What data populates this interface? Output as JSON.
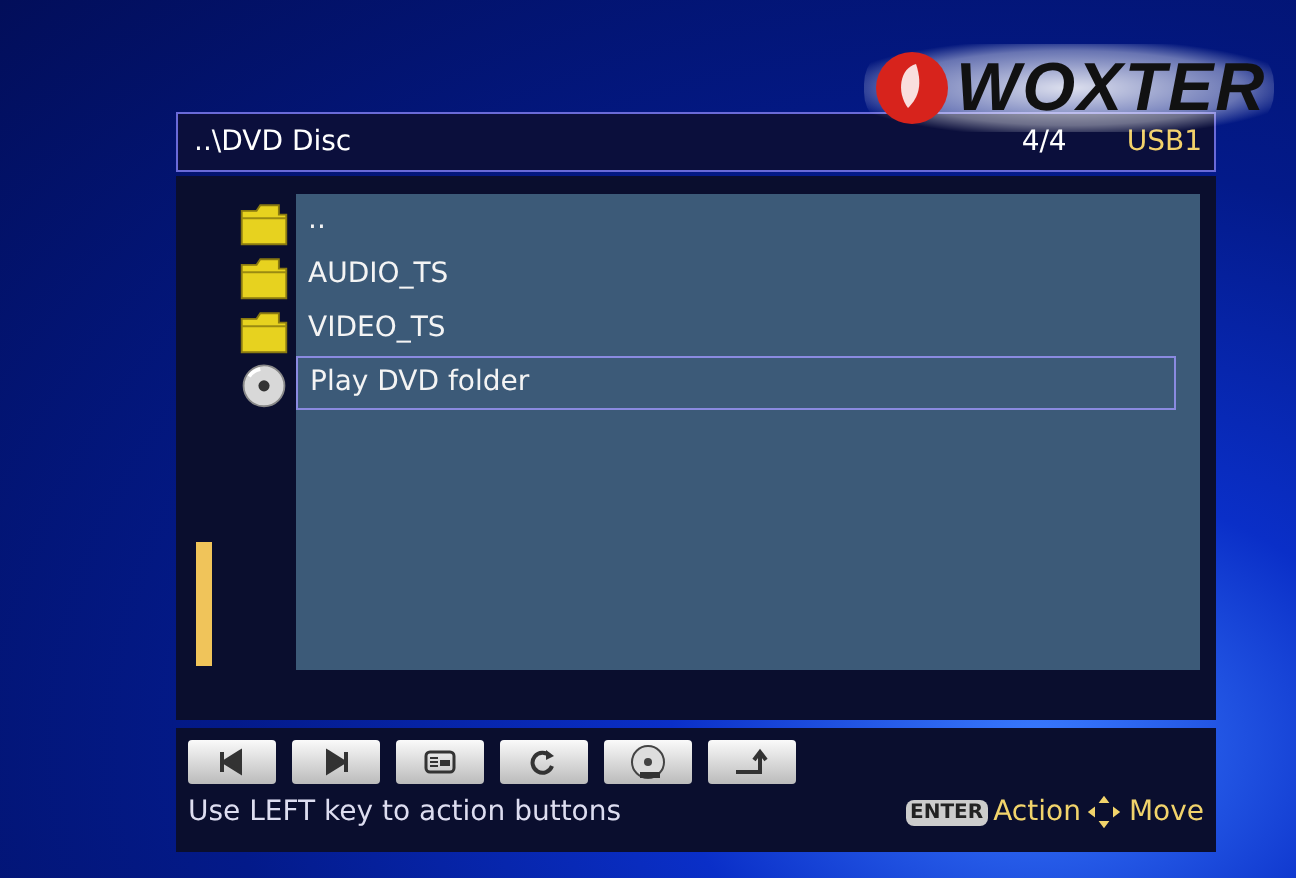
{
  "logo": {
    "text": "WOXTER"
  },
  "header": {
    "path": "..\\DVD Disc",
    "count": "4/4",
    "device": "USB1"
  },
  "files": [
    {
      "name": "..",
      "kind": "folder",
      "selected": false
    },
    {
      "name": "AUDIO_TS",
      "kind": "folder",
      "selected": false
    },
    {
      "name": "VIDEO_TS",
      "kind": "folder",
      "selected": false
    },
    {
      "name": "Play DVD folder",
      "kind": "disc",
      "selected": true
    }
  ],
  "toolbar": [
    {
      "kind": "previous"
    },
    {
      "kind": "next"
    },
    {
      "kind": "display"
    },
    {
      "kind": "repeat"
    },
    {
      "kind": "dvd"
    },
    {
      "kind": "return"
    }
  ],
  "status_bar": {
    "hint": "Use LEFT key to action buttons",
    "enter_key": "ENTER",
    "enter_label": "Action",
    "move_label": "Move"
  }
}
